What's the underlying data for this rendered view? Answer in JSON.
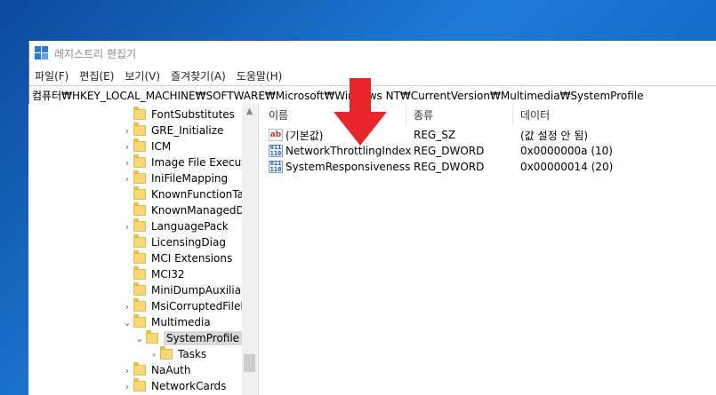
{
  "window": {
    "title": "레지스트리 편집기"
  },
  "menu": [
    "파일(F)",
    "편집(E)",
    "보기(V)",
    "즐겨찾기(A)",
    "도움말(H)"
  ],
  "address": "컴퓨터₩HKEY_LOCAL_MACHINE₩SOFTWARE₩Microsoft₩Windows NT₩CurrentVersion₩Multimedia₩SystemProfile",
  "tree": [
    {
      "label": "FontSubstitutes",
      "expander": "",
      "selected": false
    },
    {
      "label": "GRE_Initialize",
      "expander": "›",
      "selected": false
    },
    {
      "label": "ICM",
      "expander": "›",
      "selected": false
    },
    {
      "label": "Image File Executic",
      "expander": "›",
      "selected": false
    },
    {
      "label": "IniFileMapping",
      "expander": "›",
      "selected": false
    },
    {
      "label": "KnownFunctionTab",
      "expander": "",
      "selected": false
    },
    {
      "label": "KnownManagedDe",
      "expander": "",
      "selected": false
    },
    {
      "label": "LanguagePack",
      "expander": "›",
      "selected": false
    },
    {
      "label": "LicensingDiag",
      "expander": "",
      "selected": false
    },
    {
      "label": "MCI Extensions",
      "expander": "",
      "selected": false
    },
    {
      "label": "MCI32",
      "expander": "",
      "selected": false
    },
    {
      "label": "MiniDumpAuxiliary",
      "expander": "",
      "selected": false
    },
    {
      "label": "MsiCorruptedFileRe",
      "expander": "›",
      "selected": false
    },
    {
      "label": "Multimedia",
      "expander": "⌄",
      "selected": false
    },
    {
      "label": "SystemProfile",
      "expander": "⌄",
      "selected": true
    },
    {
      "label": "Tasks",
      "expander": "›",
      "selected": false
    },
    {
      "label": "NaAuth",
      "expander": "›",
      "selected": false
    },
    {
      "label": "NetworkCards",
      "expander": "›",
      "selected": false
    }
  ],
  "columns": {
    "name": "이름",
    "type": "종류",
    "data": "데이터"
  },
  "values": [
    {
      "icon": "ab",
      "name": "(기본값)",
      "type": "REG_SZ",
      "data": "(값 설정 안 됨)"
    },
    {
      "icon": "011\n110",
      "name": "NetworkThrottlingIndex",
      "type": "REG_DWORD",
      "data": "0x0000000a (10)"
    },
    {
      "icon": "011\n110",
      "name": "SystemResponsiveness",
      "type": "REG_DWORD",
      "data": "0x00000014 (20)"
    }
  ],
  "colors": {
    "accent": "#2b7bd6",
    "arrow": "#e8262b",
    "selection": "#d9d9d9",
    "folder": "#f8d775"
  }
}
